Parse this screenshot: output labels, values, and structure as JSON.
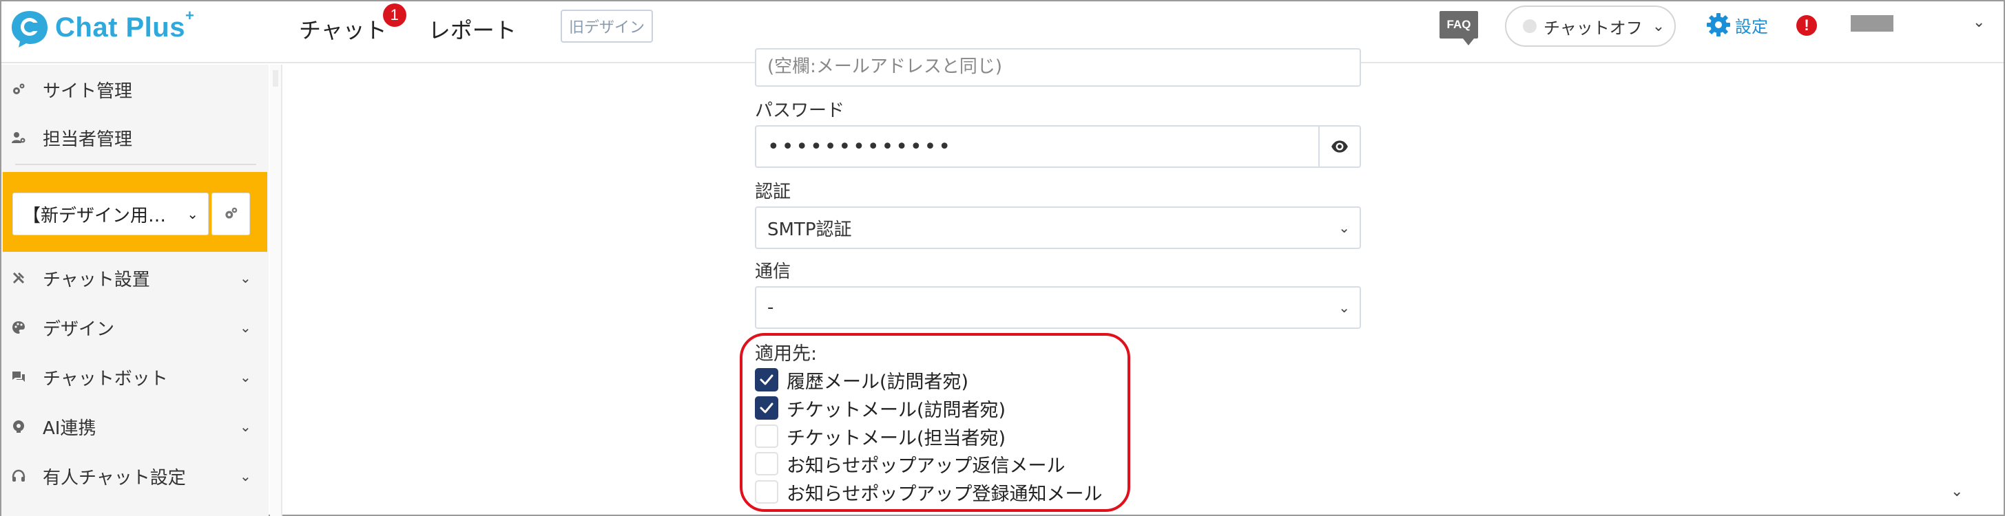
{
  "header": {
    "logo_text": "Chat Plus",
    "logo_sup": "+",
    "nav": [
      {
        "label": "チャット",
        "badge": "1"
      },
      {
        "label": "レポート"
      }
    ],
    "old_design_label": "旧デザイン",
    "faq_label": "FAQ",
    "chat_status_label": "チャットオフ",
    "settings_label": "設定",
    "alert_label": "!"
  },
  "sidebar": {
    "items": [
      {
        "label": "サイト管理",
        "icon": "gears-icon"
      },
      {
        "label": "担当者管理",
        "icon": "user-settings-icon"
      },
      {
        "label": "チャット設置",
        "icon": "tools-icon"
      },
      {
        "label": "デザイン",
        "icon": "palette-icon"
      },
      {
        "label": "チャットボット",
        "icon": "chat-bubbles-icon"
      },
      {
        "label": "AI連携",
        "icon": "ai-icon"
      },
      {
        "label": "有人チャット設定",
        "icon": "headset-icon"
      }
    ],
    "site_select_value": "【新デザイン用…",
    "site_box_color": "#fbb300"
  },
  "form": {
    "cut_placeholder": "(空欄:メールアドレスと同じ)",
    "password_label": "パスワード",
    "password_value": "•••••••••••••",
    "auth_label": "認証",
    "auth_value": "SMTP認証",
    "comm_label": "通信",
    "comm_value": "-",
    "apply_label": "適用先:",
    "checkboxes": [
      {
        "label": "履歴メール(訪問者宛)",
        "checked": true
      },
      {
        "label": "チケットメール(訪問者宛)",
        "checked": true
      },
      {
        "label": "チケットメール(担当者宛)",
        "checked": false
      },
      {
        "label": "お知らせポップアップ返信メール",
        "checked": false
      },
      {
        "label": "お知らせポップアップ登録通知メール",
        "checked": false
      }
    ]
  },
  "colors": {
    "brand": "#2fa9dc",
    "accent_blue": "#1a8fd8",
    "alert_red": "#d9141c",
    "checkbox_checked": "#203a6d",
    "highlight_border": "#e0101c"
  }
}
